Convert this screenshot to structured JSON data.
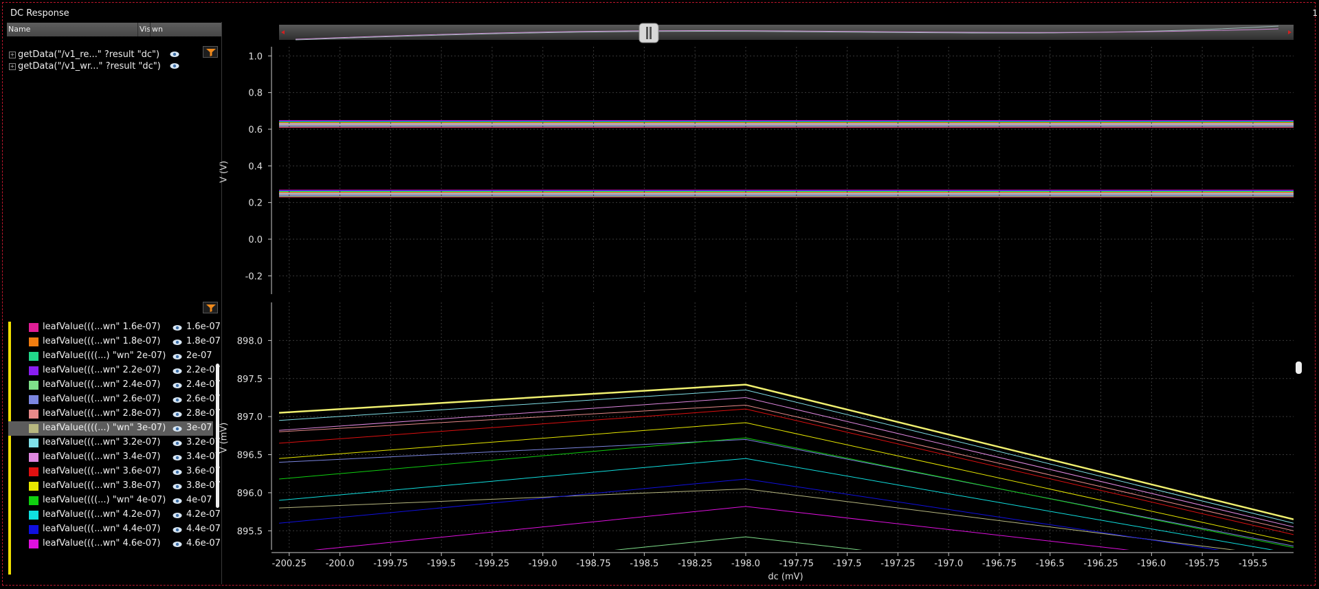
{
  "window": {
    "title": "DC Response",
    "corner_number": "1"
  },
  "left_panel": {
    "columns": [
      "Name",
      "Vis",
      "wn"
    ],
    "top_items": [
      {
        "label": "getData(\"/v1_re...\" ?result \"dc\")"
      },
      {
        "label": "getData(\"/v1_wr...\" ?result \"dc\")"
      }
    ],
    "leaf_items": [
      {
        "label": "leafValue(((...wn\" 1.6e-07)",
        "value": "1.6e-07",
        "color": "#e01e96"
      },
      {
        "label": "leafValue(((...wn\" 1.8e-07)",
        "value": "1.8e-07",
        "color": "#f07d10"
      },
      {
        "label": "leafValue((((...) \"wn\" 2e-07)",
        "value": "2e-07",
        "color": "#22d68a"
      },
      {
        "label": "leafValue(((...wn\" 2.2e-07)",
        "value": "2.2e-07",
        "color": "#8a1ef0"
      },
      {
        "label": "leafValue(((...wn\" 2.4e-07)",
        "value": "2.4e-07",
        "color": "#7fe08a"
      },
      {
        "label": "leafValue(((...wn\" 2.6e-07)",
        "value": "2.6e-07",
        "color": "#7b86e0"
      },
      {
        "label": "leafValue(((...wn\" 2.8e-07)",
        "value": "2.8e-07",
        "color": "#e88a8a"
      },
      {
        "label": "leafValue((((...) \"wn\" 3e-07)",
        "value": "3e-07",
        "color": "#b8b880",
        "selected": true
      },
      {
        "label": "leafValue(((...wn\" 3.2e-07)",
        "value": "3.2e-07",
        "color": "#80e0e8"
      },
      {
        "label": "leafValue(((...wn\" 3.4e-07)",
        "value": "3.4e-07",
        "color": "#e088e0"
      },
      {
        "label": "leafValue(((...wn\" 3.6e-07)",
        "value": "3.6e-07",
        "color": "#e01010"
      },
      {
        "label": "leafValue(((...wn\" 3.8e-07)",
        "value": "3.8e-07",
        "color": "#e8e800"
      },
      {
        "label": "leafValue((((...) \"wn\" 4e-07)",
        "value": "4e-07",
        "color": "#10d010"
      },
      {
        "label": "leafValue(((...wn\" 4.2e-07)",
        "value": "4.2e-07",
        "color": "#10e0e0"
      },
      {
        "label": "leafValue(((...wn\" 4.4e-07)",
        "value": "4.4e-07",
        "color": "#1010e0"
      },
      {
        "label": "leafValue(((...wn\" 4.6e-07)",
        "value": "4.6e-07",
        "color": "#e010e0"
      }
    ]
  },
  "chart_data": [
    {
      "type": "line",
      "title": "",
      "ylabel": "V (V)",
      "ylim": [
        -0.3,
        1.05
      ],
      "yticks": [
        "1.0",
        "0.8",
        "0.6",
        "0.4",
        "0.2",
        "0.0",
        "-0.2"
      ],
      "xlim": [
        -200.3,
        -195.3
      ],
      "grid": true,
      "series_groups": [
        {
          "name": "",
          "approx_level_V": 0.63,
          "count": 16
        },
        {
          "name": "",
          "approx_level_V": 0.25,
          "count": 16
        }
      ]
    },
    {
      "type": "line",
      "title": "",
      "xlabel": "dc (mV)",
      "ylabel": "V (mV)",
      "xlim": [
        -200.3,
        -195.3
      ],
      "ylim": [
        895.25,
        898.5
      ],
      "xticks": [
        "-200.25",
        "-200.0",
        "-199.75",
        "-199.5",
        "-199.25",
        "-199.0",
        "-198.75",
        "-198.5",
        "-198.25",
        "-198.0",
        "-197.75",
        "-197.5",
        "-197.25",
        "-197.0",
        "-196.75",
        "-196.5",
        "-196.25",
        "-196.0",
        "-195.75",
        "-195.5"
      ],
      "yticks": [
        "898.0",
        "897.5",
        "897.0",
        "896.5",
        "896.0",
        "895.5"
      ],
      "grid": true,
      "x": [
        -200.3,
        -198.0,
        -195.3
      ],
      "series": [
        {
          "name": "",
          "values": [
            897.05,
            897.42,
            895.65
          ],
          "color": "#f0f070"
        },
        {
          "name": "",
          "values": [
            896.95,
            897.35,
            895.6
          ],
          "color": "#80e0e8"
        },
        {
          "name": "",
          "values": [
            896.82,
            897.25,
            895.55
          ],
          "color": "#e088e0"
        },
        {
          "name": "",
          "values": [
            896.8,
            897.15,
            895.5
          ],
          "color": "#e88a8a"
        },
        {
          "name": "",
          "values": [
            896.65,
            897.1,
            895.45
          ],
          "color": "#e01010"
        },
        {
          "name": "",
          "values": [
            896.45,
            896.92,
            895.35
          ],
          "color": "#e8e800"
        },
        {
          "name": "",
          "values": [
            896.4,
            896.7,
            895.3
          ],
          "color": "#7b86e0"
        },
        {
          "name": "",
          "values": [
            896.18,
            896.72,
            895.28
          ],
          "color": "#10d010"
        },
        {
          "name": "",
          "values": [
            895.9,
            896.45,
            895.2
          ],
          "color": "#10e0e0"
        },
        {
          "name": "",
          "values": [
            895.8,
            896.05,
            895.15
          ],
          "color": "#b8b880"
        },
        {
          "name": "",
          "values": [
            895.6,
            896.18,
            895.1
          ],
          "color": "#1010e0"
        },
        {
          "name": "",
          "values": [
            895.2,
            895.82,
            895.0
          ],
          "color": "#e010e0"
        },
        {
          "name": "",
          "values": [
            894.8,
            895.42,
            894.6
          ],
          "color": "#7fe08a"
        }
      ]
    }
  ]
}
